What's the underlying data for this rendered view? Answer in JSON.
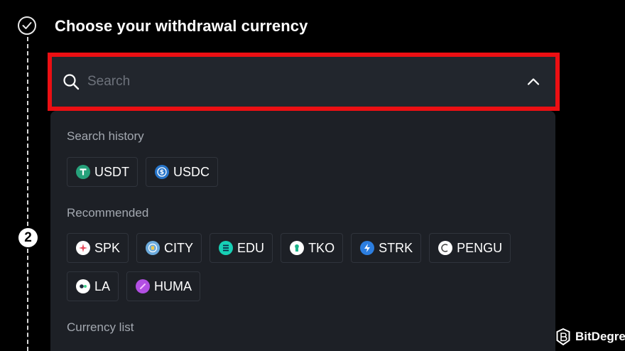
{
  "header": {
    "title": "Choose your withdrawal currency",
    "step2_number": "2"
  },
  "search": {
    "placeholder": "Search",
    "value": ""
  },
  "dropdown": {
    "history_label": "Search history",
    "history": [
      {
        "symbol": "USDT",
        "icon": "tether-icon",
        "color": "#26a17b"
      },
      {
        "symbol": "USDC",
        "icon": "usdc-icon",
        "color": "#2775ca"
      }
    ],
    "recommended_label": "Recommended",
    "recommended": [
      {
        "symbol": "SPK",
        "icon": "spk-icon",
        "color": "#ffffff"
      },
      {
        "symbol": "CITY",
        "icon": "city-icon",
        "color": "#6cabdd"
      },
      {
        "symbol": "EDU",
        "icon": "edu-icon",
        "color": "#17d0b5"
      },
      {
        "symbol": "TKO",
        "icon": "tko-icon",
        "color": "#ffffff"
      },
      {
        "symbol": "STRK",
        "icon": "strk-icon",
        "color": "#2c7ee0"
      },
      {
        "symbol": "PENGU",
        "icon": "pengu-icon",
        "color": "#ffffff"
      },
      {
        "symbol": "LA",
        "icon": "la-icon",
        "color": "#ffffff"
      },
      {
        "symbol": "HUMA",
        "icon": "huma-icon",
        "color": "#b24fe3"
      }
    ],
    "currency_list_label": "Currency list"
  },
  "watermark": {
    "text": "BitDegree"
  },
  "colors": {
    "highlight_border": "#ec0f13",
    "search_bg": "#22262d",
    "dropdown_bg": "#1d2026",
    "muted_text": "#a3a8b0"
  }
}
